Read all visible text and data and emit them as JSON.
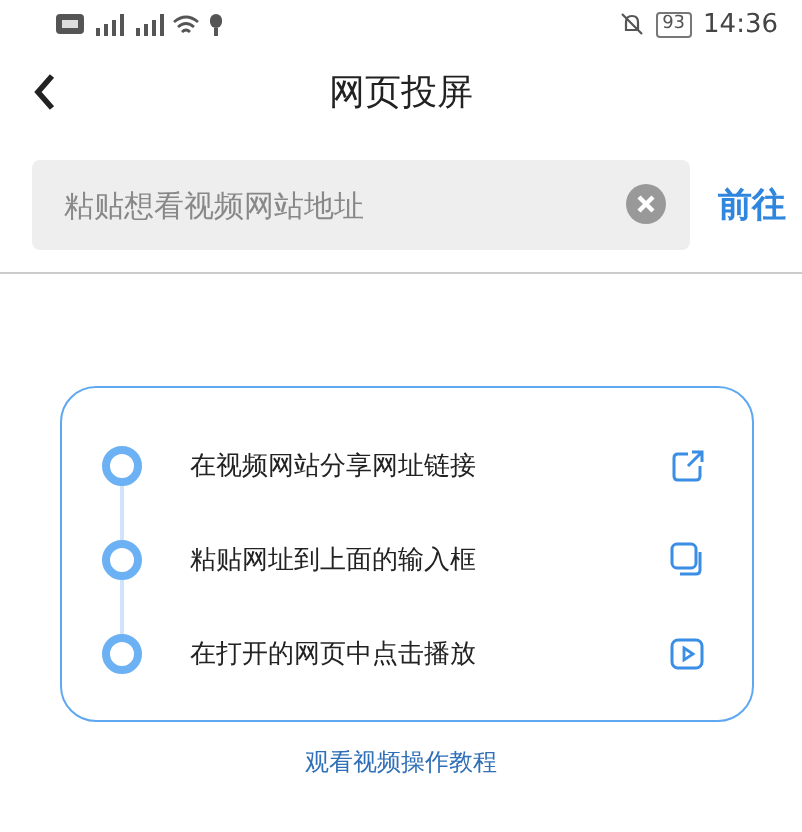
{
  "status_bar": {
    "battery": "93",
    "time": "14:36"
  },
  "header": {
    "title": "网页投屏"
  },
  "search": {
    "placeholder": "粘贴想看视频网站地址",
    "action": "前往"
  },
  "steps": [
    {
      "text": "在视频网站分享网址链接",
      "kind": "share"
    },
    {
      "text": "粘贴网址到上面的输入框",
      "kind": "copy"
    },
    {
      "text": "在打开的网页中点击播放",
      "kind": "play"
    }
  ],
  "tutorial_link": "观看视频操作教程"
}
